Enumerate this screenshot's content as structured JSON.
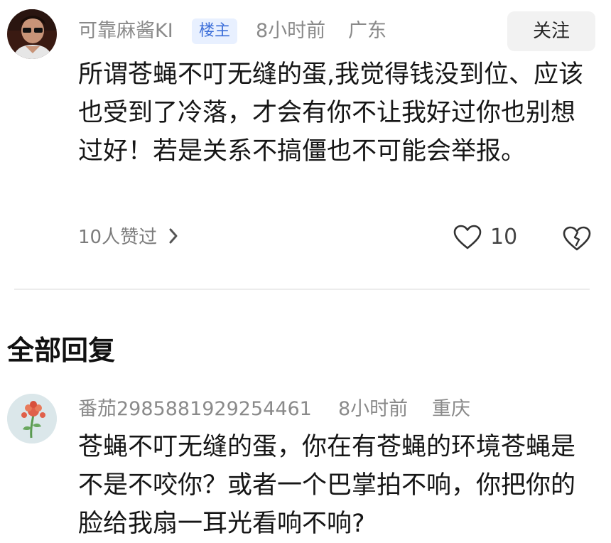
{
  "main_comment": {
    "username": "可靠麻酱KI",
    "badge": "楼主",
    "time": "8小时前",
    "location": "广东",
    "follow_label": "关注",
    "text": "所谓苍蝇不叮无缝的蛋,我觉得钱没到位、应该也受到了冷落，才会有你不让我好过你也别想过好！若是关系不搞僵也不可能会举报。",
    "likes_text": "10人赞过",
    "like_count": "10"
  },
  "replies": {
    "title": "全部回复",
    "items": [
      {
        "username": "番茄2985881929254461",
        "time": "8小时前",
        "location": "重庆",
        "text": "苍蝇不叮无缝的蛋，你在有苍蝇的环境苍蝇是不是不咬你？或者一个巴掌拍不响，你把你的脸给我扇一耳光看响不响?"
      }
    ]
  },
  "icons": {
    "like": "heart-icon",
    "dislike": "broken-heart-icon",
    "chevron": "chevron-right-icon"
  }
}
